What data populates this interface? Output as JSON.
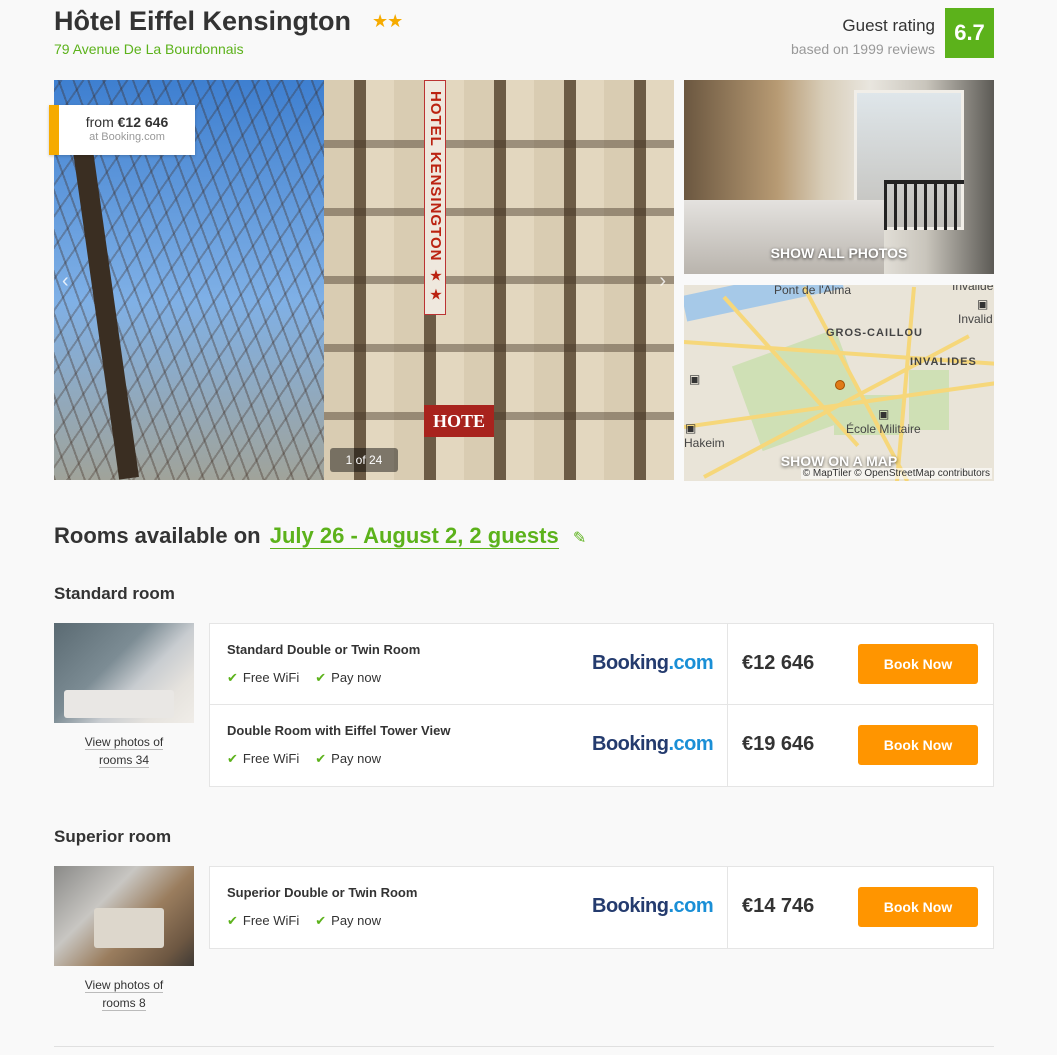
{
  "hotel": {
    "name": "Hôtel Eiffel Kensington",
    "stars": "★★",
    "address": "79 Avenue De La Bourdonnais"
  },
  "rating": {
    "label": "Guest rating",
    "sub": "based on 1999 reviews",
    "score": "6.7"
  },
  "gallery": {
    "price_from_label": "from",
    "price_from_value": "€12 646",
    "price_source": "at Booking.com",
    "counter": "1 of 24",
    "sign_vertical": "HOTEL KENSINGTON ★★",
    "sign_hote": "HOTE",
    "show_all_photos": "SHOW ALL PHOTOS",
    "show_on_map": "SHOW ON A MAP",
    "prev_icon": "‹",
    "next_icon": "›"
  },
  "map": {
    "labels": {
      "pont": "Pont de l'Alma",
      "gros": "GROS-CAILLOU",
      "invalides": "INVALIDES",
      "invalid_r": "Invalid",
      "invalide_top": "Invalide",
      "ecole": "École Militaire",
      "hakeim": "Hakeim"
    },
    "attribution": "© MapTiler © OpenStreetMap contributors"
  },
  "rooms_header": {
    "prefix": "Rooms available on",
    "dates": "July 26 - August 2, 2 guests"
  },
  "categories": [
    {
      "title": "Standard room",
      "view_photos_1": "View photos of",
      "view_photos_2": "rooms 34",
      "offers": [
        {
          "name": "Standard Double or Twin Room",
          "f1": "Free WiFi",
          "f2": "Pay now",
          "provider_a": "Booking",
          "provider_b": ".com",
          "price": "€12 646",
          "cta": "Book Now"
        },
        {
          "name": "Double Room with Eiffel Tower View",
          "f1": "Free WiFi",
          "f2": "Pay now",
          "provider_a": "Booking",
          "provider_b": ".com",
          "price": "€19 646",
          "cta": "Book Now"
        }
      ]
    },
    {
      "title": "Superior room",
      "view_photos_1": "View photos of",
      "view_photos_2": "rooms 8",
      "offers": [
        {
          "name": "Superior Double or Twin Room",
          "f1": "Free WiFi",
          "f2": "Pay now",
          "provider_a": "Booking",
          "provider_b": ".com",
          "price": "€14 746",
          "cta": "Book Now"
        }
      ]
    }
  ],
  "colors": {
    "accent_green": "#5cb21b",
    "star": "#f6ab00",
    "cta_orange": "#ff9500",
    "booking_navy": "#243b6e",
    "booking_blue": "#1a8fd6"
  }
}
